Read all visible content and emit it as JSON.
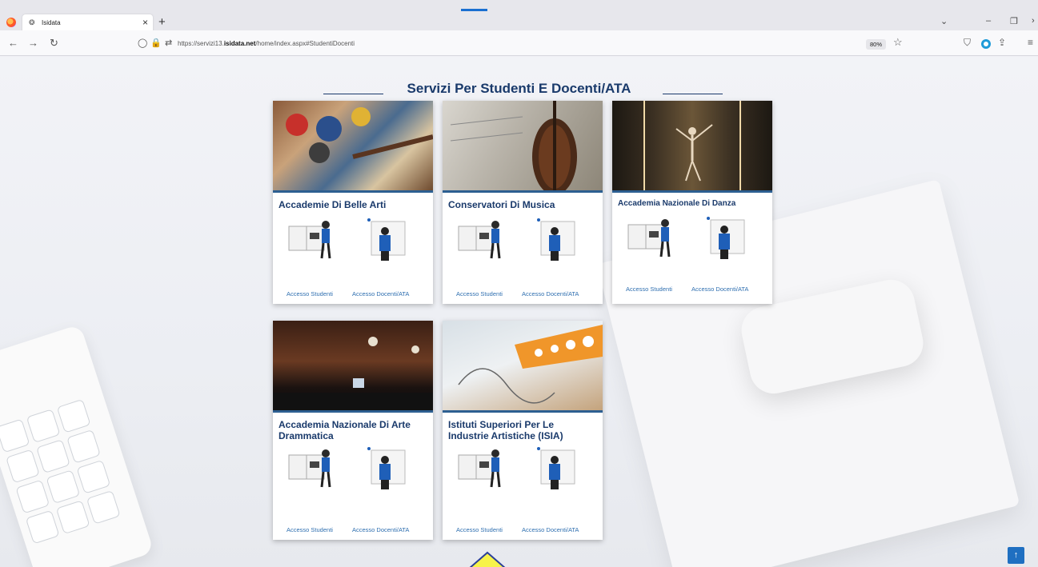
{
  "browser": {
    "tab_title": "Isidata",
    "tab_favicon": "❂",
    "tab_close": "×",
    "new_tab": "+",
    "url_prefix": "https://servizi13.",
    "url_domain": "isidata.net",
    "url_path": "/home/index.aspx#StudentiDocenti",
    "zoom": "80%"
  },
  "page": {
    "section_title": "Servizi Per Studenti E Docenti/ATA",
    "link_students": "Accesso Studenti",
    "link_teachers": "Accesso Docenti/ATA",
    "cards": [
      {
        "title": "Accademie Di Belle Arti",
        "image": "paint-palette-photo"
      },
      {
        "title": "Conservatori Di Musica",
        "image": "violin-sheet-music-photo"
      },
      {
        "title": "Accademia Nazionale Di Danza",
        "image": "ballet-dancer-photo"
      },
      {
        "title": "Accademia Nazionale Di Arte Drammatica",
        "image": "theatre-stage-photo"
      },
      {
        "title": "Istituti Superiori Per Le Industrie Artistiche (ISIA)",
        "image": "design-drawing-photo"
      }
    ],
    "scroll_top": "↑"
  },
  "colors": {
    "title": "#1a3a6b",
    "link": "#2f6fb0",
    "card_accent": "#2d5f91",
    "scroll_button": "#1f6fc1"
  }
}
